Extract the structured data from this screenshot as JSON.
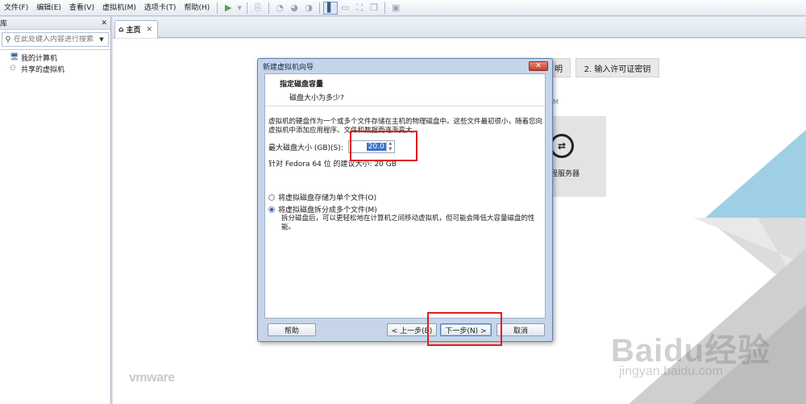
{
  "menubar": {
    "items": [
      "文件(F)",
      "编辑(E)",
      "查看(V)",
      "虚拟机(M)",
      "选项卡(T)",
      "帮助(H)"
    ]
  },
  "library": {
    "title": "库",
    "search_placeholder": "在此处键入内容进行搜索",
    "tree": [
      "我的计算机",
      "共享的虚拟机"
    ]
  },
  "tabs": [
    {
      "label": "主页"
    }
  ],
  "home": {
    "btn_license": "2. 输入许可证密钥",
    "btn_left_fragment": "明",
    "side_fragment": "M",
    "tile_label": "远程服务器",
    "logo": "vmware"
  },
  "dialog": {
    "title": "新建虚拟机向导",
    "header": "指定磁盘容量",
    "subheader": "磁盘大小为多少?",
    "description": "虚拟机的硬盘作为一个或多个文件存储在主机的物理磁盘中。这些文件最初很小，随着您向虚拟机中添加应用程序、文件和数据而逐渐变大。",
    "max_size_label": "最大磁盘大小 (GB)(S):",
    "max_size_value": "20.0",
    "recommendation": "针对 Fedora 64 位 的建议大小: 20 GB",
    "option_single": "将虚拟磁盘存储为单个文件(O)",
    "option_split": "将虚拟磁盘拆分成多个文件(M)",
    "split_note": "拆分磁盘后，可以更轻松地在计算机之间移动虚拟机，但可能会降低大容量磁盘的性能。",
    "btn_help": "帮助",
    "btn_back": "< 上一步(B)",
    "btn_next": "下一步(N) >",
    "btn_cancel": "取消"
  },
  "watermark": {
    "text": "Baidu经验",
    "url": "jingyan.baidu.com"
  },
  "colors": {
    "highlight_red": "#e21c1c",
    "selection_blue": "#3a74c6",
    "brand_teal": "#9fcfe4"
  }
}
